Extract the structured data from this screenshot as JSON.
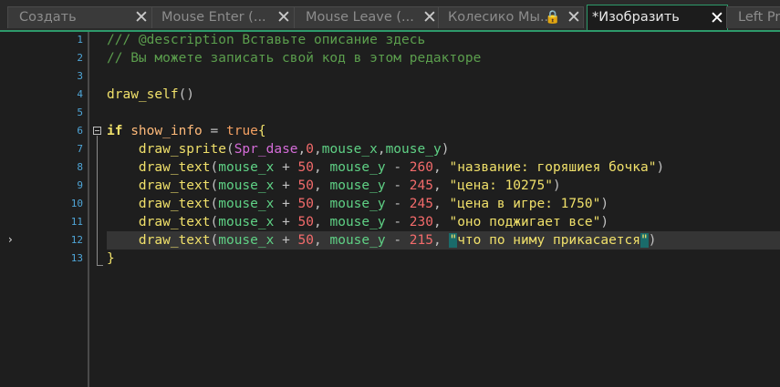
{
  "tabs": [
    {
      "label": "Создать",
      "active": false
    },
    {
      "label": "Mouse Enter (...",
      "active": false
    },
    {
      "label": "Mouse Leave (...",
      "active": false
    },
    {
      "label": "Колесико Мы...",
      "active": false,
      "locked": true
    },
    {
      "label": "*Изобразить",
      "active": true
    },
    {
      "label": "Left Pre",
      "active": false
    }
  ],
  "close_glyph": "✕",
  "lock_glyph": "🔒",
  "marker_glyph": "›",
  "line_numbers": [
    "1",
    "2",
    "3",
    "4",
    "5",
    "6",
    "7",
    "8",
    "9",
    "10",
    "11",
    "12",
    "13"
  ],
  "code": {
    "l1": "/// @description Вставьте описание здесь",
    "l2": "// Вы можете записать свой код в этом редакторе",
    "l4_fn": "draw_self",
    "l4_rest": "()",
    "l6_kw": "if",
    "l6_var": "show_info",
    "l6_op": " = ",
    "l6_lit": "true",
    "l6_brace": "{",
    "l7_fn": "draw_sprite",
    "l7_sprite": "Spr_dase",
    "l7_num": "0",
    "l7_a": "mouse_x",
    "l7_b": "mouse_y",
    "l8_fn": "draw_text",
    "l8_x": "mouse_x",
    "l8_n1": "50",
    "l8_y": "mouse_y",
    "l8_n2": "260",
    "l8_str": "\"название: горяшиея бочка\"",
    "l9_fn": "draw_text",
    "l9_x": "mouse_x",
    "l9_n1": "50",
    "l9_y": "mouse_y",
    "l9_n2": "245",
    "l9_str": "\"цена: 10275\"",
    "l10_fn": "draw_text",
    "l10_x": "mouse_x",
    "l10_n1": "50",
    "l10_y": "mouse_y",
    "l10_n2": "245",
    "l10_str": "\"цена в игре: 1750\"",
    "l11_fn": "draw_text",
    "l11_x": "mouse_x",
    "l11_n1": "50",
    "l11_y": "mouse_y",
    "l11_n2": "230",
    "l11_str": "\"оно поджигает все\"",
    "l12_fn": "draw_text",
    "l12_x": "mouse_x",
    "l12_n1": "50",
    "l12_y": "mouse_y",
    "l12_n2": "215",
    "l12_q1": "\"",
    "l12_str": "что по ниму прикасается",
    "l12_q2": "\"",
    "l13": "}"
  },
  "colors": {
    "accent": "#2e9a6b",
    "line_number": "#4fa6d8",
    "comment": "#5b9e4d",
    "function": "#f0e06a",
    "variable": "#ffba7a",
    "number": "#f36b6b",
    "sprite": "#d46cd8"
  }
}
